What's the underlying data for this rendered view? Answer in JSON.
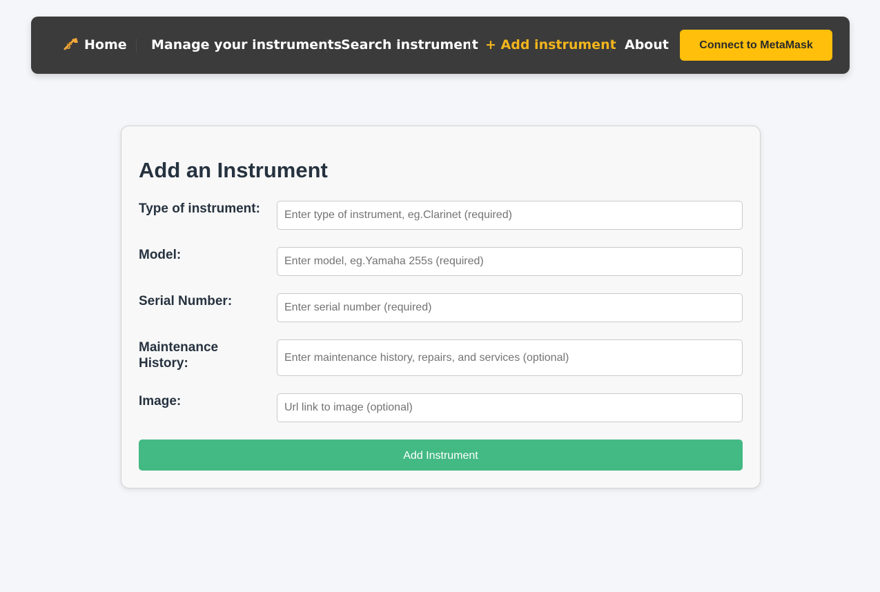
{
  "nav": {
    "home": "Home",
    "manage": "Manage your instruments",
    "search": "Search instrument",
    "add": "+ Add instrument",
    "about": "About",
    "connect": "Connect to MetaMask",
    "home_icon": "trumpet-icon",
    "active_color": "#f2b51c",
    "connect_color": "#ffbf0a"
  },
  "form": {
    "title": "Add an Instrument",
    "fields": [
      {
        "label": "Type of instrument:",
        "placeholder": "Enter type of instrument, eg.Clarinet (required)",
        "value": ""
      },
      {
        "label": "Model:",
        "placeholder": "Enter model, eg.Yamaha 255s (required)",
        "value": ""
      },
      {
        "label": "Serial Number:",
        "placeholder": "Enter serial number (required)",
        "value": ""
      },
      {
        "label": "Maintenance History:",
        "placeholder": "Enter maintenance history, repairs, and services (optional)",
        "value": ""
      },
      {
        "label": "Image:",
        "placeholder": "Url link to image (optional)",
        "value": ""
      }
    ],
    "submit": "Add Instrument",
    "submit_color": "#43b984"
  }
}
